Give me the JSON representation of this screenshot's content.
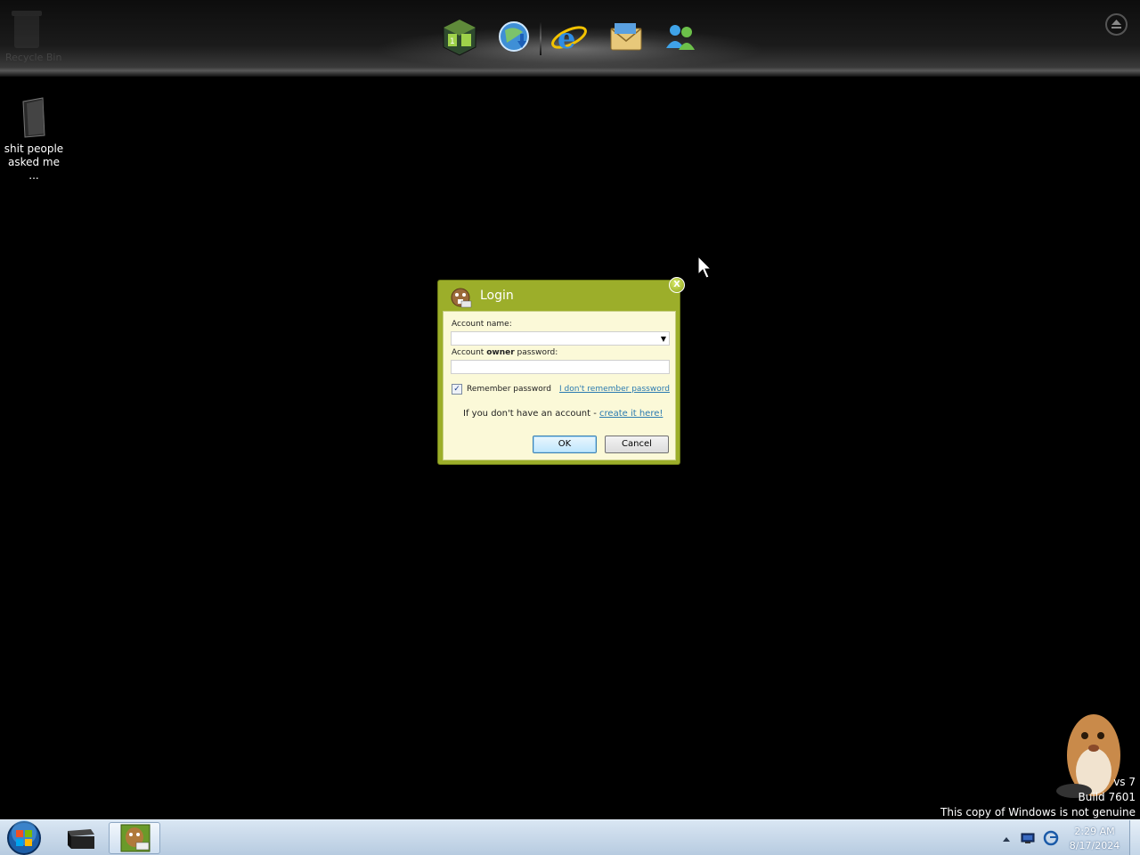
{
  "desktop": {
    "recycle_bin_label": "Recycle Bin",
    "icons": [
      {
        "label": "shit people asked me ..."
      }
    ]
  },
  "dock": {
    "items": [
      {
        "icon": "media-center-icon"
      },
      {
        "icon": "browser-download-icon"
      },
      {
        "icon": "internet-explorer-icon"
      },
      {
        "icon": "mail-icon"
      },
      {
        "icon": "messenger-icon"
      }
    ]
  },
  "dialog": {
    "title": "Login",
    "close_label": "X",
    "account_name_label": "Account name:",
    "account_name_value": "",
    "password_label_prefix": "Account ",
    "password_label_bold": "owner",
    "password_label_suffix": " password:",
    "password_value": "",
    "remember_label": "Remember password",
    "remember_checked": true,
    "forgot_link": "I don't remember password",
    "no_account_text": "If you don't have an account - ",
    "create_link": "create it here!",
    "ok_label": "OK",
    "cancel_label": "Cancel"
  },
  "watermark": {
    "line1": "vs 7",
    "line2": "Build 7601",
    "line3": "This copy of Windows is not genuine"
  },
  "taskbar": {
    "clock_time": "2:29 AM",
    "clock_date": "8/17/2024",
    "accent": "#b7cbe0"
  }
}
